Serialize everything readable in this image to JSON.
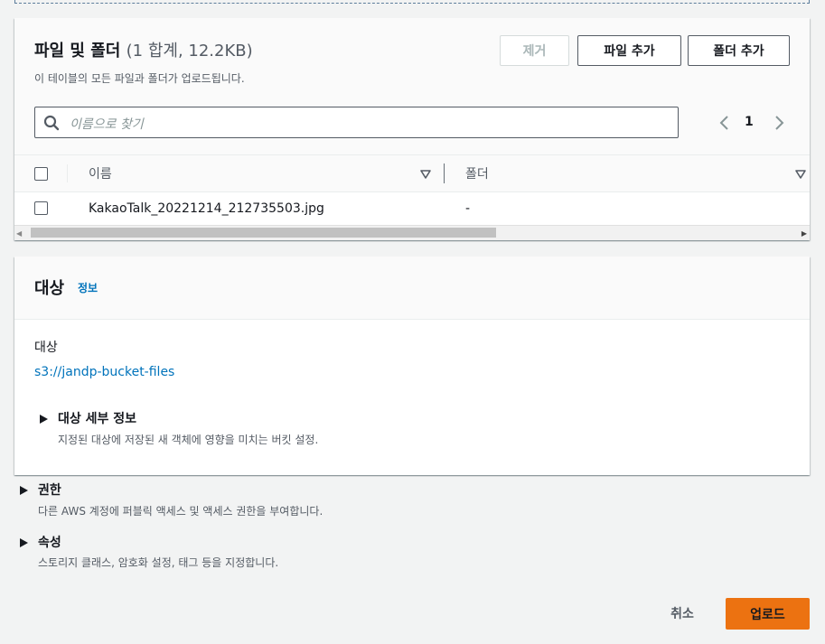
{
  "files_panel": {
    "title": "파일 및 폴더",
    "count": "(1 합계, 12.2KB)",
    "description": "이 테이블의 모든 파일과 폴더가 업로드됩니다.",
    "remove_label": "제거",
    "add_files_label": "파일 추가",
    "add_folder_label": "폴더 추가",
    "search_placeholder": "이름으로 찾기",
    "current_page": "1",
    "columns": [
      "이름",
      "폴더"
    ],
    "rows": [
      {
        "name": "KakaoTalk_20221214_212735503.jpg",
        "folder": "-"
      }
    ]
  },
  "destination": {
    "title": "대상",
    "info_link": "정보",
    "label": "대상",
    "url": "s3://jandp-bucket-files",
    "details_title": "대상 세부 정보",
    "details_desc": "지정된 대상에 저장된 새 객체에 영향을 미치는 버킷 설정."
  },
  "permissions": {
    "title": "권한",
    "desc": "다른 AWS 계정에 퍼블릭 액세스 및 액세스 권한을 부여합니다."
  },
  "properties": {
    "title": "속성",
    "desc": "스토리지 클래스, 암호화 설정, 태그 등을 지정합니다."
  },
  "footer": {
    "cancel_label": "취소",
    "upload_label": "업로드"
  },
  "colors": {
    "accent": "#ec7211",
    "link": "#0073bb",
    "background": "#f2f3f3"
  },
  "icons": [
    "search-icon",
    "chevron-left-icon",
    "chevron-right-icon",
    "sort-down-icon",
    "caret-right-icon"
  ]
}
